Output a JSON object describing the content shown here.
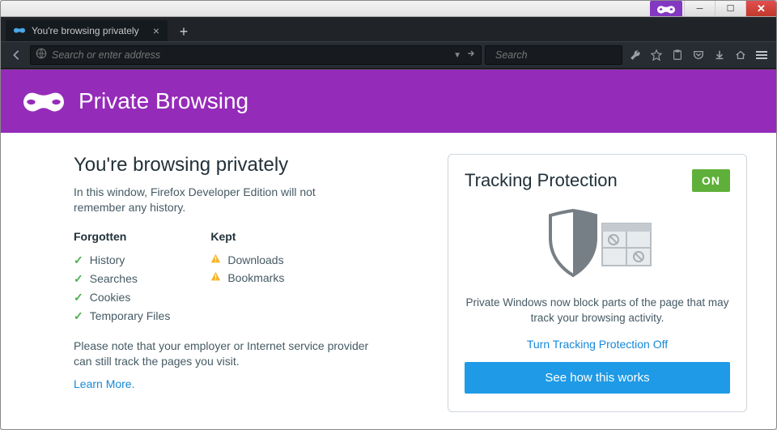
{
  "os_window": {
    "minimize_char": "─",
    "maximize_char": "☐",
    "close_char": "✕"
  },
  "tab": {
    "title": "You're browsing privately",
    "close_char": "×"
  },
  "newtab_char": "+",
  "urlbar": {
    "placeholder": "Search or enter address",
    "dropdown_char": "▼"
  },
  "searchbar": {
    "placeholder": "Search"
  },
  "hero": {
    "title": "Private Browsing"
  },
  "left": {
    "heading": "You're browsing privately",
    "intro": "In this window, Firefox Developer Edition will not remember any history.",
    "forgotten_label": "Forgotten",
    "kept_label": "Kept",
    "forgotten": [
      "History",
      "Searches",
      "Cookies",
      "Temporary Files"
    ],
    "kept": [
      "Downloads",
      "Bookmarks"
    ],
    "note": "Please note that your employer or Internet service provider can still track the pages you visit.",
    "learn_more": "Learn More."
  },
  "panel": {
    "heading": "Tracking Protection",
    "badge": "ON",
    "desc": "Private Windows now block parts of the page that may track your browsing activity.",
    "turn_off": "Turn Tracking Protection Off",
    "cta": "See how this works"
  },
  "colors": {
    "brand_purple": "#952bb9",
    "link_blue": "#1588d8",
    "cta_blue": "#1e9ae6",
    "badge_green": "#5fb03a"
  }
}
